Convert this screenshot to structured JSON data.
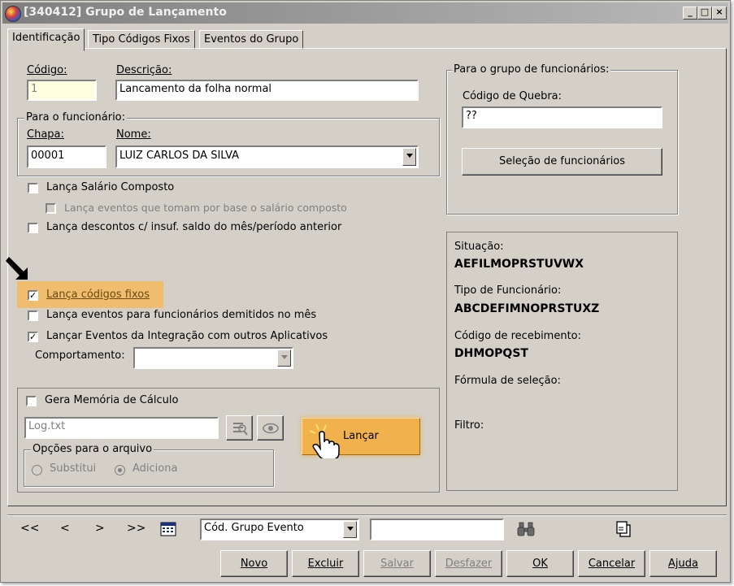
{
  "window": {
    "title": "[340412]  Grupo de Lançamento",
    "minimize": "_",
    "maximize": "□",
    "close": "×"
  },
  "tabs": [
    {
      "label": "Identificação"
    },
    {
      "label": "Tipo Códigos Fixos"
    },
    {
      "label": "Eventos do Grupo"
    }
  ],
  "form": {
    "codigo_label": "Código:",
    "codigo_value": "1",
    "descricao_label": "Descrição:",
    "descricao_value": "Lancamento da folha normal",
    "funcionario_group": "Para o funcionário:",
    "chapa_label": "Chapa:",
    "chapa_value": "00001",
    "nome_label": "Nome:",
    "nome_value": "LUIZ CARLOS DA SILVA",
    "lanca_salario": "Lança Salário Composto",
    "lanca_eventos_base": "Lança eventos que tomam por base o salário composto",
    "lanca_descontos": "Lança descontos c/ insuf. saldo do mês/período anterior",
    "lanca_codigos_fixos": "Lança códigos fixos",
    "lanca_demitidos": "Lança eventos para funcionários demitidos no mês",
    "lancar_integracao": "Lançar Eventos da Integração com outros Aplicativos",
    "comportamento_label": "Comportamento:",
    "comportamento_value": "",
    "gera_memoria": "Gera Memória de Cálculo",
    "log_value": "Log.txt",
    "opcoes_group": "Opções para o arquivo",
    "substitui": "Substitui",
    "adiciona": "Adiciona",
    "lancar_button": "Lançar"
  },
  "grupo_funcionarios": {
    "caption": "Para o grupo de funcionários:",
    "quebra_label": "Código de Quebra:",
    "quebra_value": "??",
    "selecao_button": "Seleção de funcionários"
  },
  "info": {
    "situacao_label": "Situação:",
    "situacao_value": "AEFILMOPRSTUVWX",
    "tipo_label": "Tipo de Funcionário:",
    "tipo_value": "ABCDEFIMNOPRSTUXZ",
    "recebimento_label": "Código de recebimento:",
    "recebimento_value": "DHMOPQST",
    "formula_label": "Fórmula de seleção:",
    "filtro_label": "Filtro:"
  },
  "navigation": {
    "first": "<<",
    "prev": "<",
    "next": ">",
    "last": ">>",
    "field_value": "Cód. Grupo Evento",
    "search_value": ""
  },
  "buttons": {
    "novo": "Novo",
    "excluir": "Excluir",
    "salvar": "Salvar",
    "desfazer": "Desfazer",
    "ok": "OK",
    "cancelar": "Cancelar",
    "ajuda": "Ajuda"
  },
  "checkmark": "✓",
  "colors": {
    "highlight": "#f6b857",
    "window_bg": "#d4d0c8",
    "titlebar": "#8a8a8a"
  }
}
